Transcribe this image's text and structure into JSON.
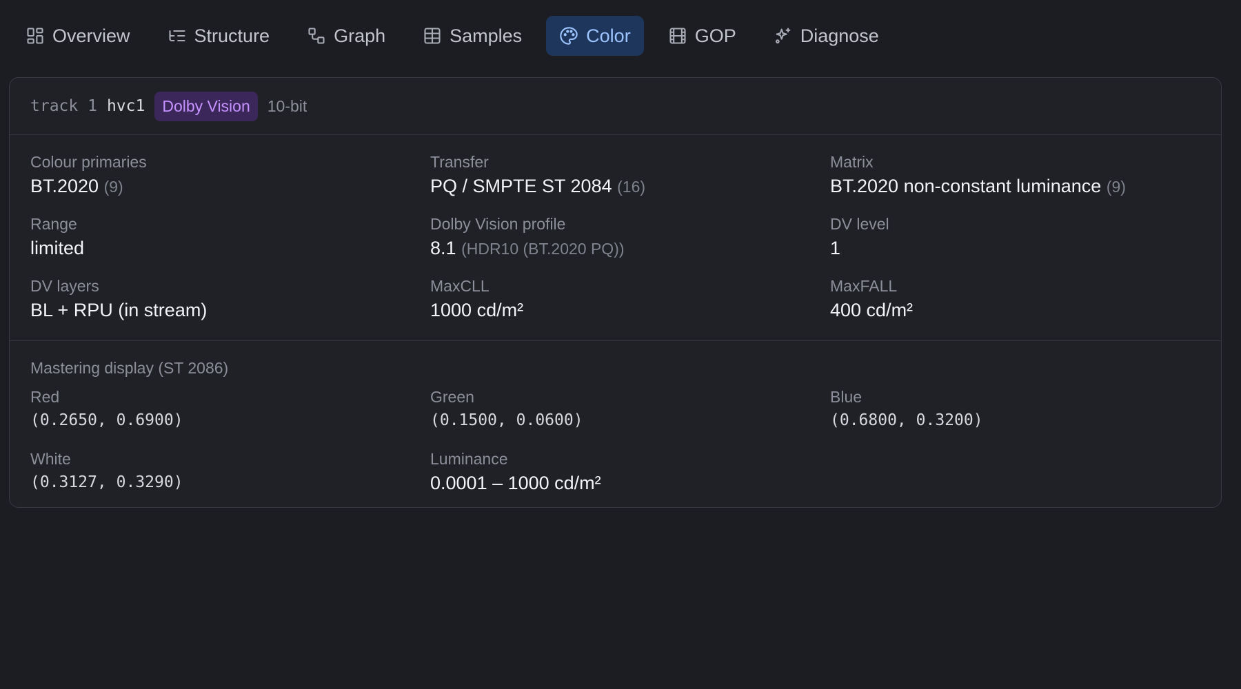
{
  "tabs": [
    {
      "label": "Overview",
      "icon": "grid-icon"
    },
    {
      "label": "Structure",
      "icon": "list-tree-icon"
    },
    {
      "label": "Graph",
      "icon": "graph-icon"
    },
    {
      "label": "Samples",
      "icon": "table-icon"
    },
    {
      "label": "Color",
      "icon": "palette-icon",
      "active": true
    },
    {
      "label": "GOP",
      "icon": "film-icon"
    },
    {
      "label": "Diagnose",
      "icon": "sparkles-icon"
    }
  ],
  "track": {
    "id_text": "track 1",
    "codec": "hvc1",
    "badge": "Dolby Vision",
    "bit_depth": "10-bit"
  },
  "props": {
    "primaries": {
      "label": "Colour primaries",
      "value": "BT.2020",
      "code": "(9)"
    },
    "transfer": {
      "label": "Transfer",
      "value": "PQ / SMPTE ST 2084",
      "code": "(16)"
    },
    "matrix": {
      "label": "Matrix",
      "value": "BT.2020 non-constant luminance",
      "code": "(9)"
    },
    "range": {
      "label": "Range",
      "value": "limited"
    },
    "dv_profile": {
      "label": "Dolby Vision profile",
      "value": "8.1",
      "code": "(HDR10 (BT.2020 PQ))"
    },
    "dv_level": {
      "label": "DV level",
      "value": "1"
    },
    "dv_layers": {
      "label": "DV layers",
      "value": "BL + RPU (in stream)"
    },
    "maxcll": {
      "label": "MaxCLL",
      "value": "1000 cd/m²"
    },
    "maxfall": {
      "label": "MaxFALL",
      "value": "400 cd/m²"
    }
  },
  "mastering": {
    "title": "Mastering display (ST 2086)",
    "red": {
      "label": "Red",
      "value": "(0.2650, 0.6900)"
    },
    "green": {
      "label": "Green",
      "value": "(0.1500, 0.0600)"
    },
    "blue": {
      "label": "Blue",
      "value": "(0.6800, 0.3200)"
    },
    "white": {
      "label": "White",
      "value": "(0.3127, 0.3290)"
    },
    "luminance": {
      "label": "Luminance",
      "value": "0.0001 – 1000 cd/m²"
    }
  },
  "colors": {
    "accent": "#9cc4ff",
    "active_tab_bg": "#1f365c",
    "badge_bg": "#3b2759",
    "badge_fg": "#c592ff"
  }
}
